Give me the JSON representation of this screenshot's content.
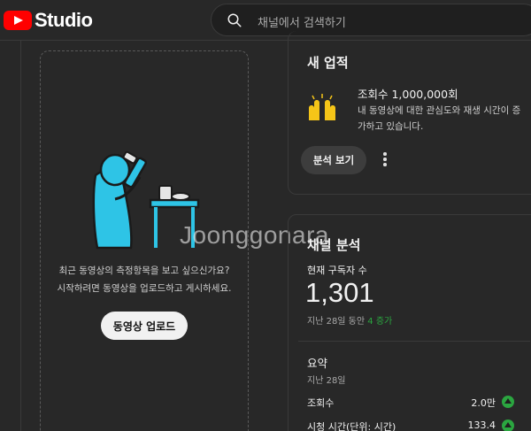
{
  "header": {
    "logo_text": "Studio",
    "search_placeholder": "채널에서 검색하기"
  },
  "upload": {
    "message_line1": "최근 동영상의 측정항목을 보고 싶으신가요?",
    "message_line2": "시작하려면 동영상을 업로드하고 게시하세요.",
    "button_label": "동영상 업로드",
    "illustration_icon": "microscope-illustration-icon"
  },
  "watermark": "Joonggonara",
  "achievement": {
    "title": "새 업적",
    "icon": "raising-hands-icon",
    "headline": "조회수 1,000,000회",
    "description": "내 동영상에 대한 관심도와 재생 시간이 증가하고 있습니다.",
    "button_label": "분석 보기"
  },
  "analytics": {
    "title": "채널 분석",
    "subscribers_label": "현재 구독자 수",
    "subscribers_count": "1,301",
    "change_prefix": "지난 28일 동안",
    "change_value": "4 증가",
    "summary_title": "요약",
    "summary_period": "지난 28일",
    "rows": [
      {
        "label": "조회수",
        "value": "2.0만",
        "trend": "up"
      },
      {
        "label": "시청 시간(단위: 시간)",
        "value": "133.4",
        "trend": "up"
      }
    ]
  },
  "colors": {
    "background": "#282828",
    "brand_red": "#ff0000",
    "trend_up": "#2ba640",
    "illustration_cyan": "#2ec4e6"
  }
}
